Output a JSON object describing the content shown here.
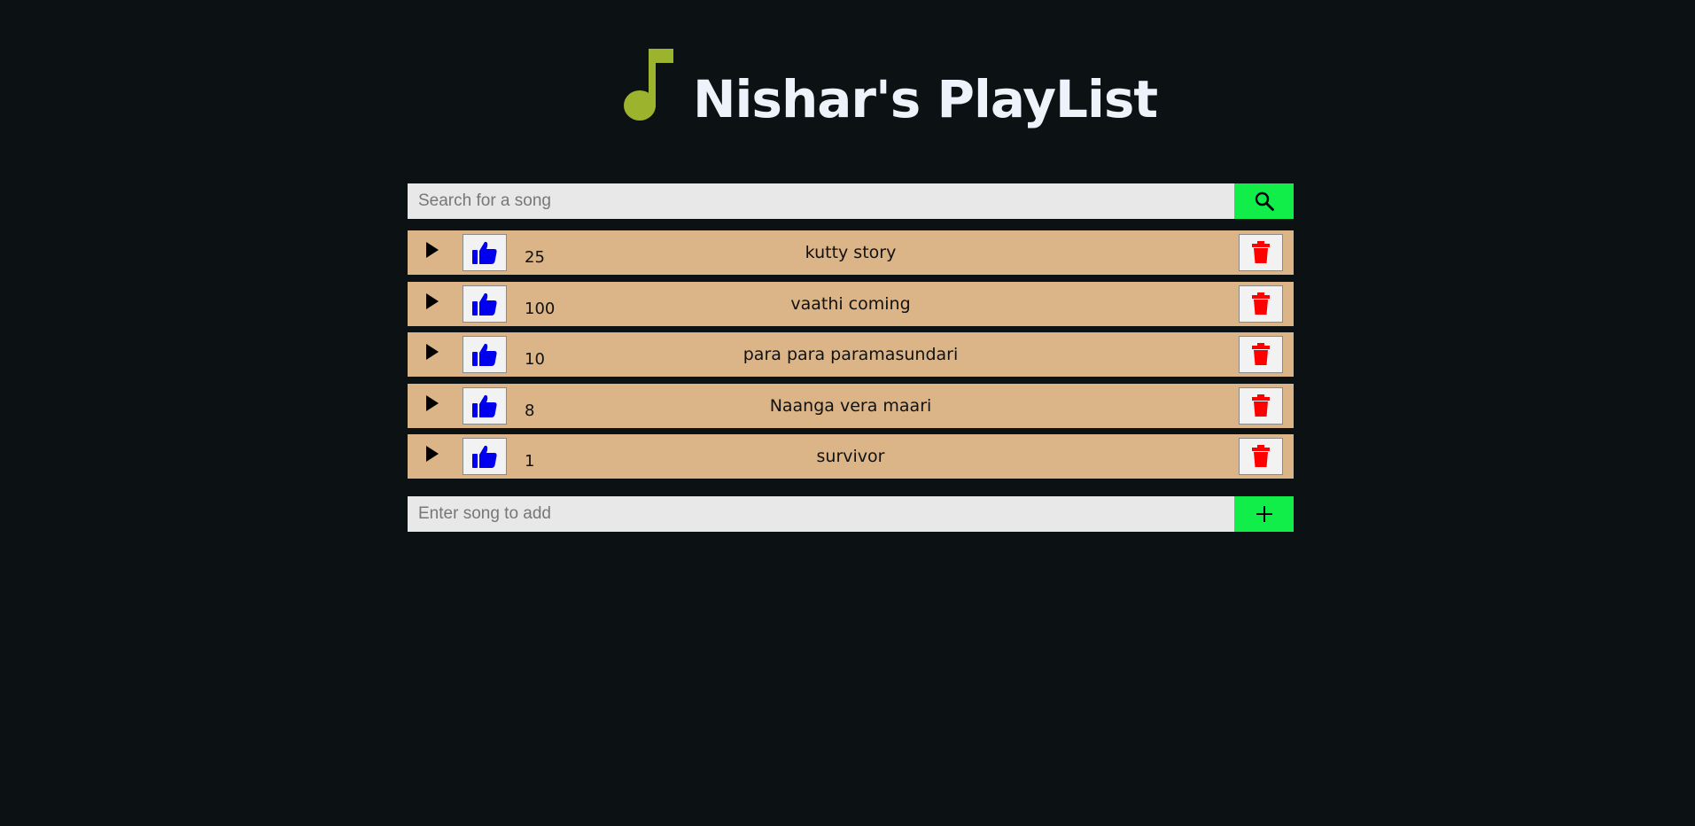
{
  "header": {
    "title": "Nishar's PlayList",
    "icon": "music-note-icon",
    "icon_color": "#9cb32e"
  },
  "search": {
    "placeholder": "Search for a song",
    "value": "",
    "button_icon": "search-icon"
  },
  "playlist": {
    "row_color": "#dbb587",
    "like_color": "#0000ee",
    "delete_color": "#ff0000",
    "songs": [
      {
        "likes": "25",
        "title": "kutty story"
      },
      {
        "likes": "100",
        "title": "vaathi coming"
      },
      {
        "likes": "10",
        "title": "para para paramasundari"
      },
      {
        "likes": "8",
        "title": "Naanga vera maari"
      },
      {
        "likes": "1",
        "title": "survivor"
      }
    ]
  },
  "add": {
    "placeholder": "Enter song to add",
    "value": "",
    "button_icon": "plus-icon"
  },
  "colors": {
    "background": "#0c1213",
    "accent_green": "#11ee4a"
  }
}
